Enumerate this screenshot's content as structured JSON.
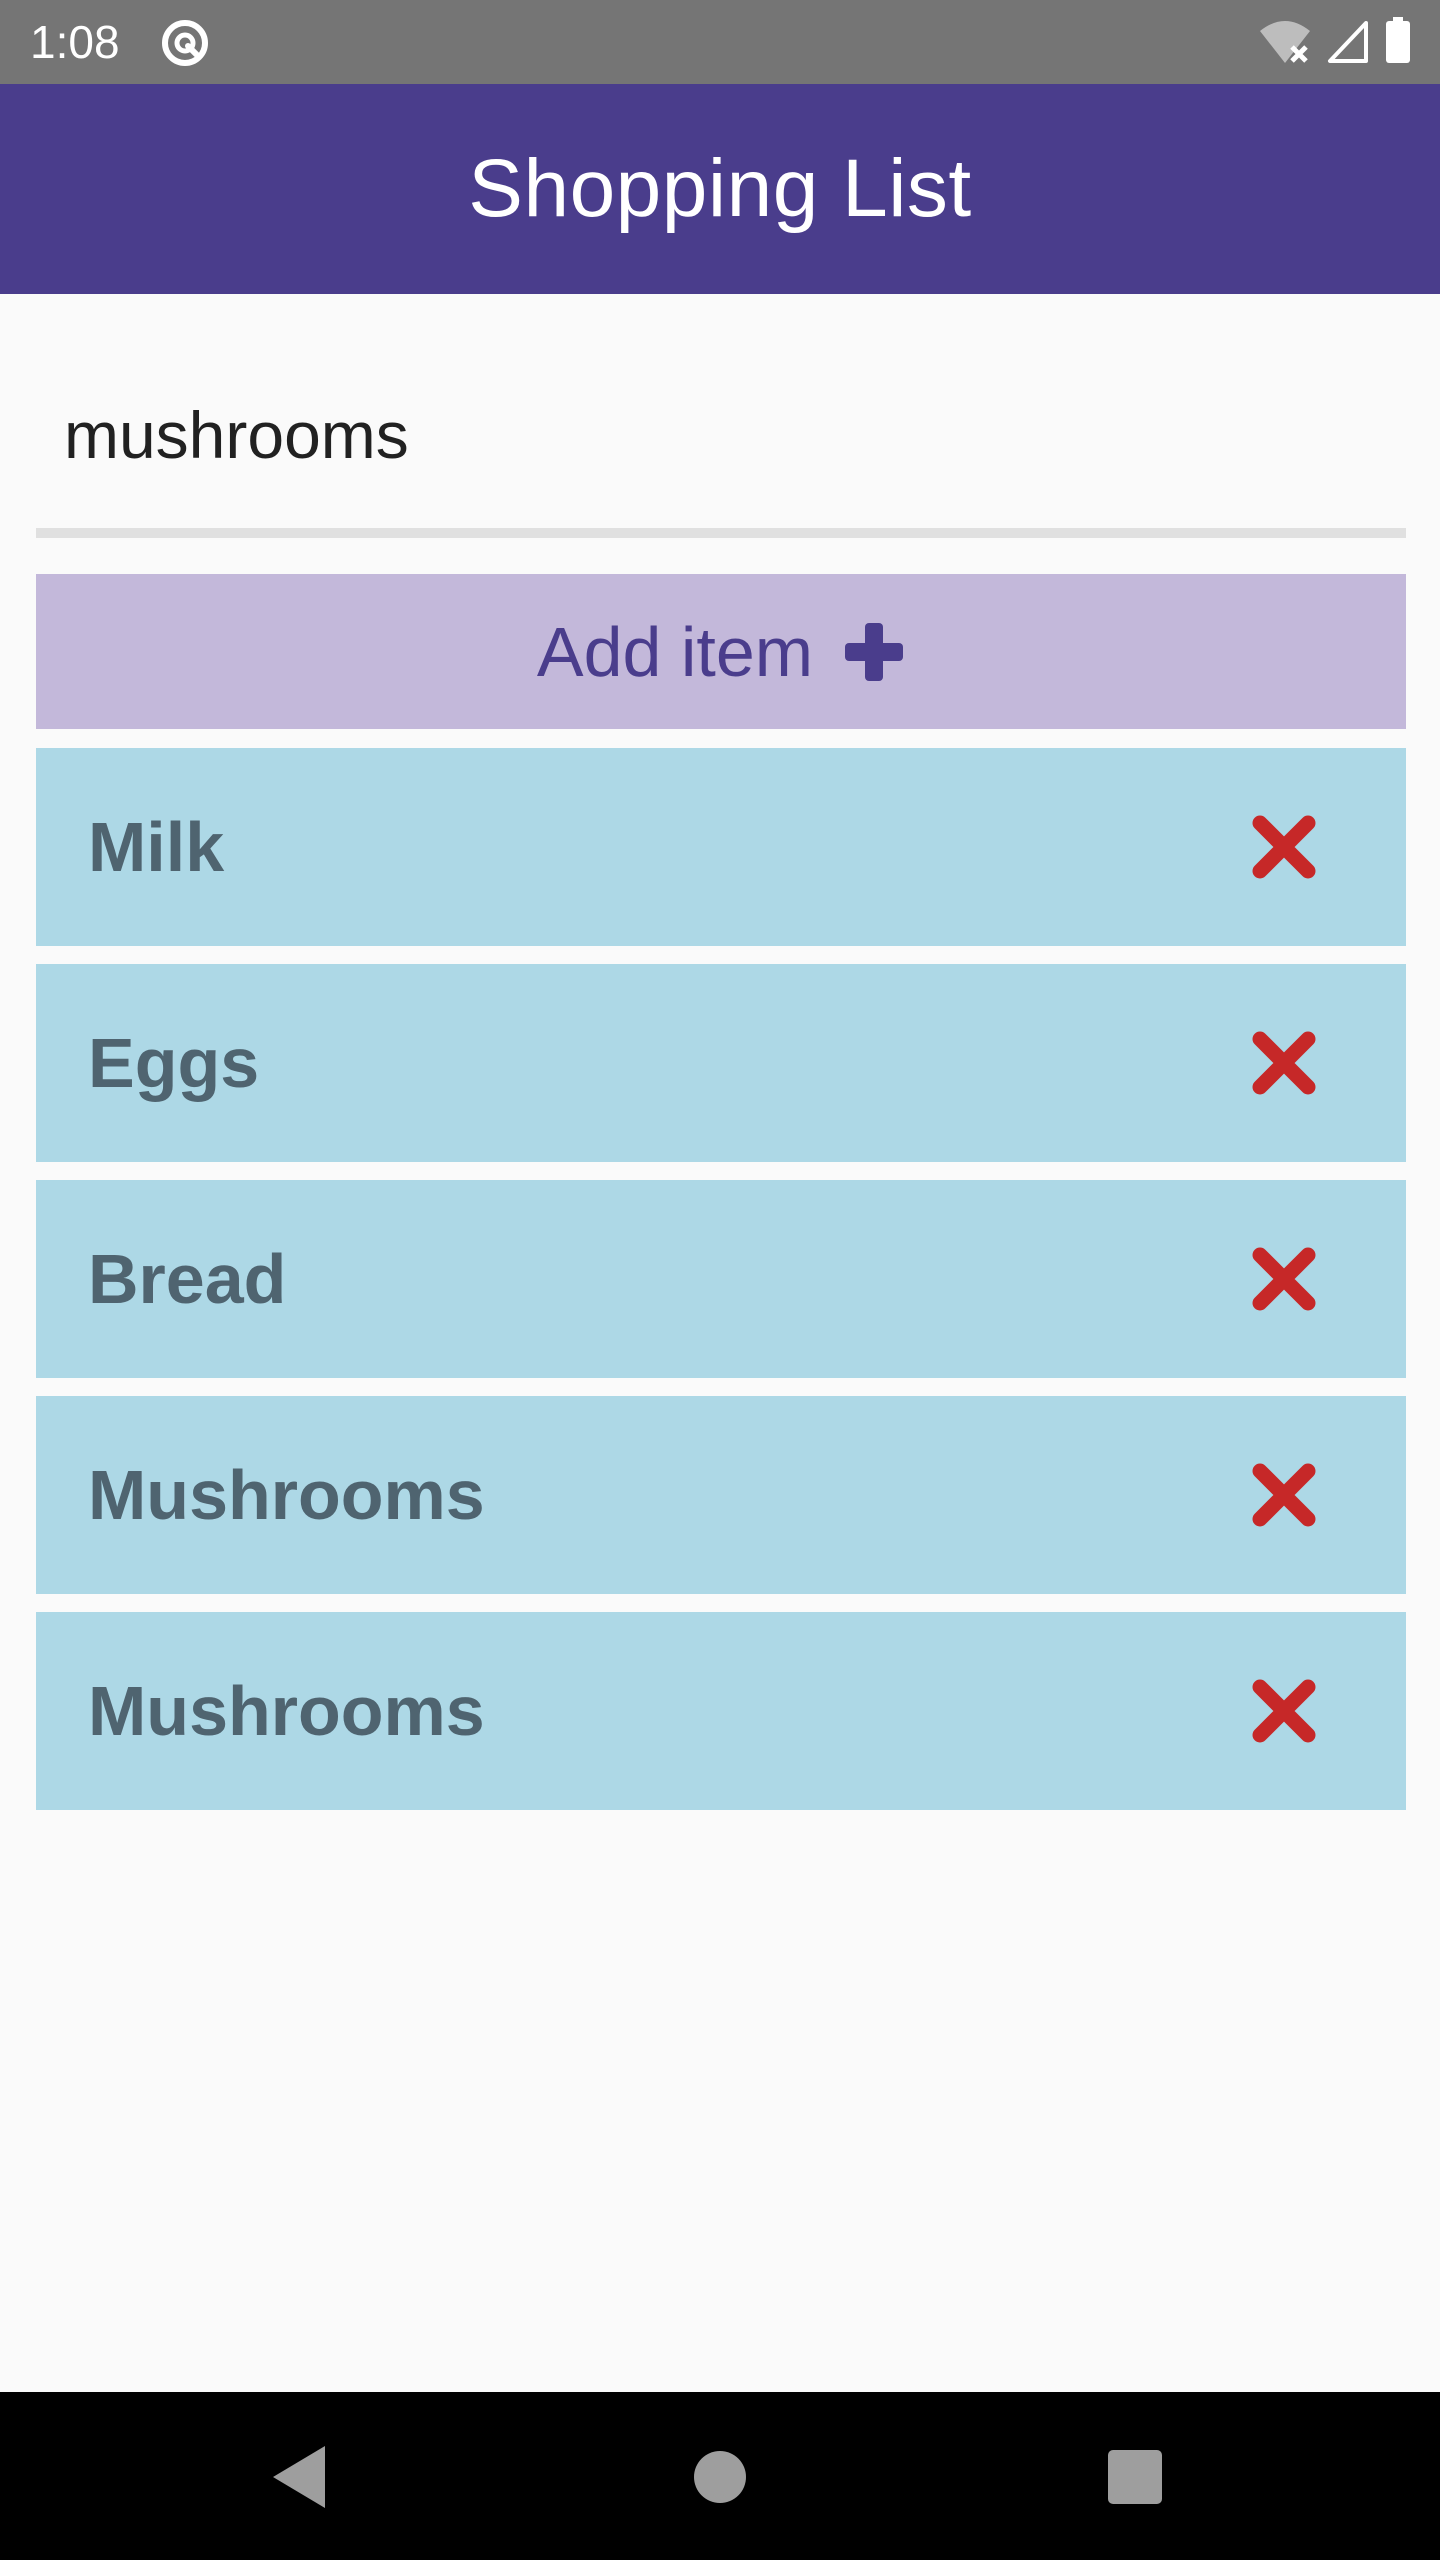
{
  "status_bar": {
    "time": "1:08",
    "left_icon": "data-saver-icon",
    "right_icons": [
      "wifi-off-icon",
      "cell-signal-icon",
      "battery-icon"
    ]
  },
  "app_bar": {
    "title": "Shopping List",
    "color": "#4a3d8c"
  },
  "input": {
    "value": "mushrooms",
    "placeholder": ""
  },
  "add_button": {
    "label": "Add item",
    "icon": "plus-icon",
    "background": "#c3b8da"
  },
  "items": [
    {
      "label": "Milk"
    },
    {
      "label": "Eggs"
    },
    {
      "label": "Bread"
    },
    {
      "label": "Mushrooms"
    },
    {
      "label": "Mushrooms"
    }
  ],
  "item_style": {
    "background": "#add8e6",
    "delete_icon": "close-icon",
    "delete_color": "#c62828"
  },
  "nav_bar": {
    "buttons": [
      "back-icon",
      "home-icon",
      "recents-icon"
    ]
  }
}
